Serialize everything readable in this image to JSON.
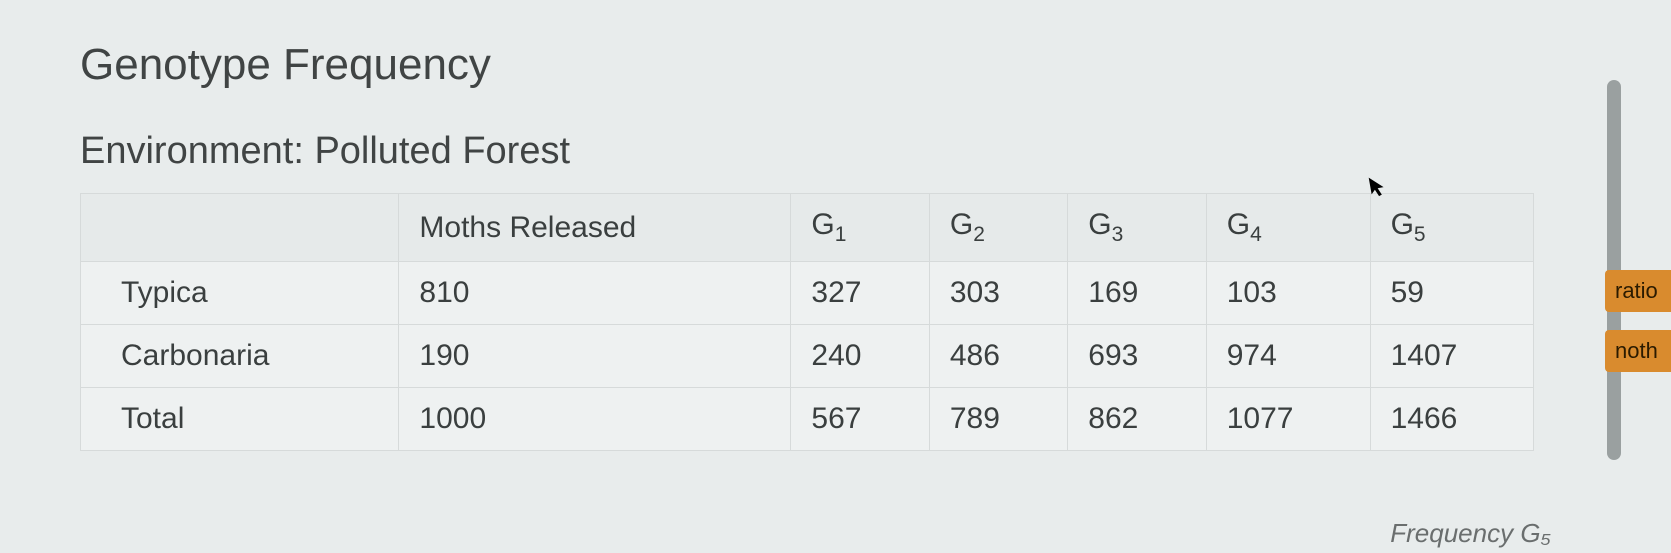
{
  "title": "Genotype Frequency",
  "subtitle": "Environment: Polluted Forest",
  "columns": {
    "c0": "",
    "c1": "Moths Released",
    "c2": "G",
    "c2sub": "1",
    "c3": "G",
    "c3sub": "2",
    "c4": "G",
    "c4sub": "3",
    "c5": "G",
    "c5sub": "4",
    "c6": "G",
    "c6sub": "5"
  },
  "rows": {
    "r0": {
      "label": "Typica",
      "v1": "810",
      "v2": "327",
      "v3": "303",
      "v4": "169",
      "v5": "103",
      "v6": "59"
    },
    "r1": {
      "label": "Carbonaria",
      "v1": "190",
      "v2": "240",
      "v3": "486",
      "v4": "693",
      "v5": "974",
      "v6": "1407"
    },
    "r2": {
      "label": "Total",
      "v1": "1000",
      "v2": "567",
      "v3": "789",
      "v4": "862",
      "v5": "1077",
      "v6": "1466"
    }
  },
  "tabs": {
    "t0": "ratio",
    "t1": "noth"
  },
  "footer_fragment": "Frequency G₅",
  "chart_data": {
    "type": "table",
    "title": "Genotype Frequency — Environment: Polluted Forest",
    "columns": [
      "",
      "Moths Released",
      "G1",
      "G2",
      "G3",
      "G4",
      "G5"
    ],
    "rows": [
      [
        "Typica",
        810,
        327,
        303,
        169,
        103,
        59
      ],
      [
        "Carbonaria",
        190,
        240,
        486,
        693,
        974,
        1407
      ],
      [
        "Total",
        1000,
        567,
        789,
        862,
        1077,
        1466
      ]
    ]
  }
}
